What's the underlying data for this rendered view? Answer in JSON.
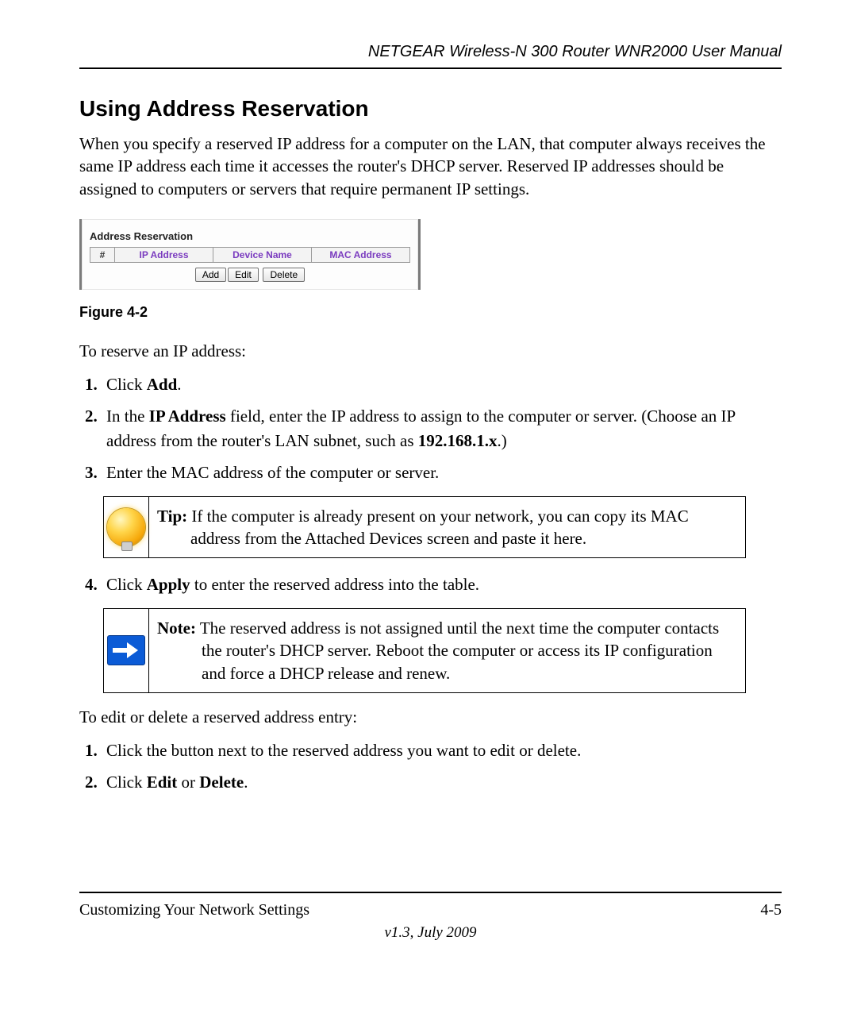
{
  "header": {
    "running_title": "NETGEAR Wireless-N 300 Router WNR2000 User Manual"
  },
  "section": {
    "heading": "Using Address Reservation",
    "intro": "When you specify a reserved IP address for a computer on the LAN, that computer always receives the same IP address each time it accesses the router's DHCP server. Reserved IP addresses should be assigned to computers or servers that require permanent IP settings."
  },
  "figure": {
    "panel_title": "Address Reservation",
    "columns": {
      "num": "#",
      "ip": "IP Address",
      "device": "Device Name",
      "mac": "MAC Address"
    },
    "buttons": {
      "add": "Add",
      "edit": "Edit",
      "delete": "Delete"
    },
    "caption": "Figure 4-2"
  },
  "reserve": {
    "lead": "To reserve an IP address:",
    "step1_pre": "Click ",
    "step1_b": "Add",
    "step1_post": ".",
    "step2_a": "In the ",
    "step2_b1": "IP Address",
    "step2_c": " field, enter the IP address to assign to the computer or server. (Choose an IP address from the router's LAN subnet, such as ",
    "step2_b2": "192.168.1.x",
    "step2_d": ".)",
    "step3": "Enter the MAC address of the computer or server.",
    "step4_a": "Click ",
    "step4_b": "Apply",
    "step4_c": " to enter the reserved address into the table."
  },
  "tip": {
    "label": "Tip:",
    "text": " If the computer is already present on your network, you can copy its MAC address from the Attached Devices screen and paste it here."
  },
  "note": {
    "label": "Note:",
    "text": " The reserved address is not assigned until the next time the computer contacts the router's DHCP server. Reboot the computer or access its IP configuration and force a DHCP release and renew."
  },
  "edit": {
    "lead": "To edit or delete a reserved address entry:",
    "step1": "Click the button next to the reserved address you want to edit or delete.",
    "step2_a": "Click ",
    "step2_b1": "Edit",
    "step2_mid": " or ",
    "step2_b2": "Delete",
    "step2_end": "."
  },
  "footer": {
    "left": "Customizing Your Network Settings",
    "right": "4-5",
    "version": "v1.3, July 2009"
  }
}
